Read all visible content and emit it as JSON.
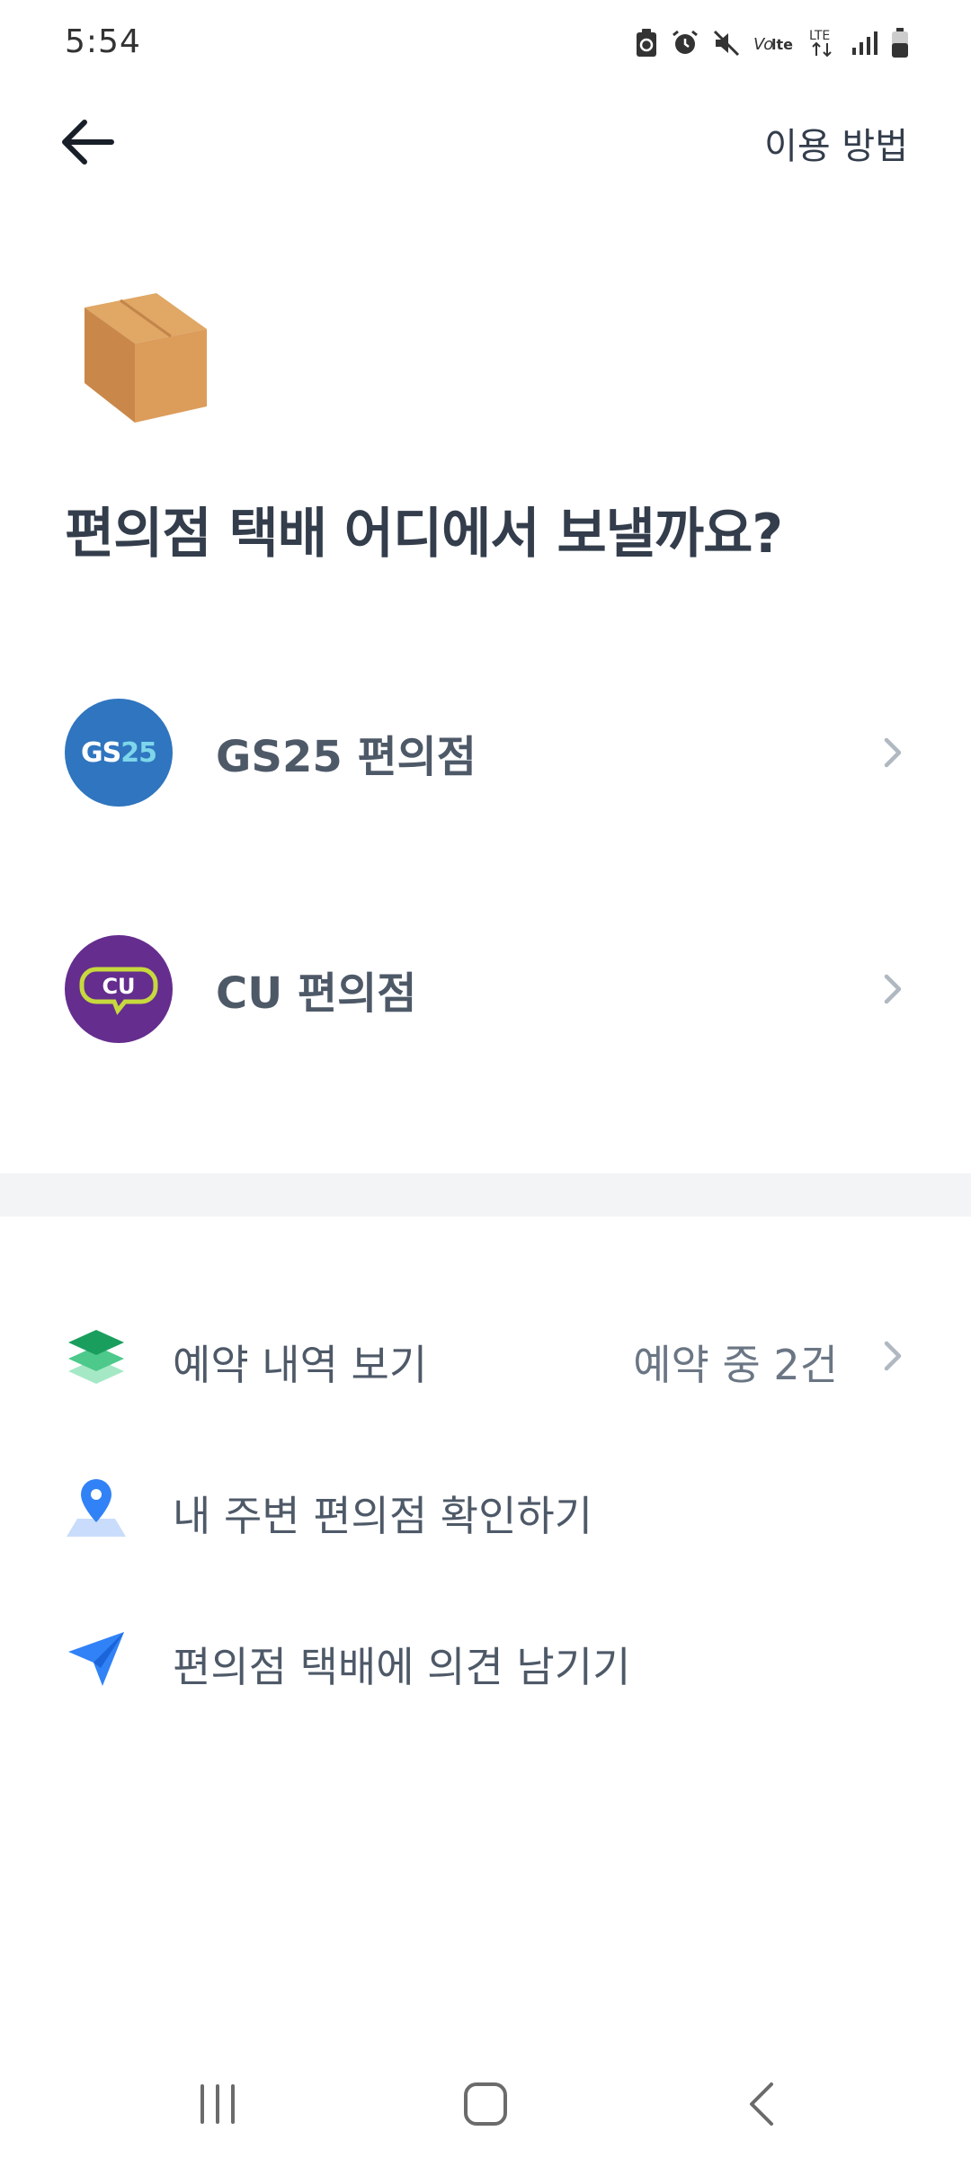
{
  "status_bar": {
    "time": "5:54",
    "icons": [
      "battery-saver-icon",
      "alarm-icon",
      "mute-icon",
      "volte-icon",
      "lte-icon",
      "signal-icon",
      "battery-icon"
    ]
  },
  "header": {
    "back_icon": "arrow-left-icon",
    "help_label": "이용 방법"
  },
  "hero": {
    "illustration": "package-box-icon",
    "title": "편의점 택배 어디에서 보낼까요?"
  },
  "stores": [
    {
      "logo_text_prefix": "GS",
      "logo_text_suffix": "25",
      "label": "GS25 편의점",
      "logo_color": "#2f75bf"
    },
    {
      "logo_text": "CU",
      "label": "CU 편의점",
      "logo_color": "#652d8e",
      "logo_accent": "#c7d93d"
    }
  ],
  "menu": [
    {
      "icon": "layers-icon",
      "label": "예약 내역 보기",
      "status": "예약 중 2건"
    },
    {
      "icon": "map-pin-icon",
      "label": "내 주변 편의점 확인하기"
    },
    {
      "icon": "paper-plane-icon",
      "label": "편의점 택배에 의견 남기기"
    }
  ],
  "nav_bar": {
    "recent_icon": "recent-apps-icon",
    "home_icon": "home-icon",
    "back_icon": "nav-back-icon"
  },
  "colors": {
    "title_text": "#333d4b",
    "body_text": "#4e5968",
    "divider": "#f2f4f6",
    "accent_green": "#1bb374",
    "accent_blue": "#3182f6"
  }
}
